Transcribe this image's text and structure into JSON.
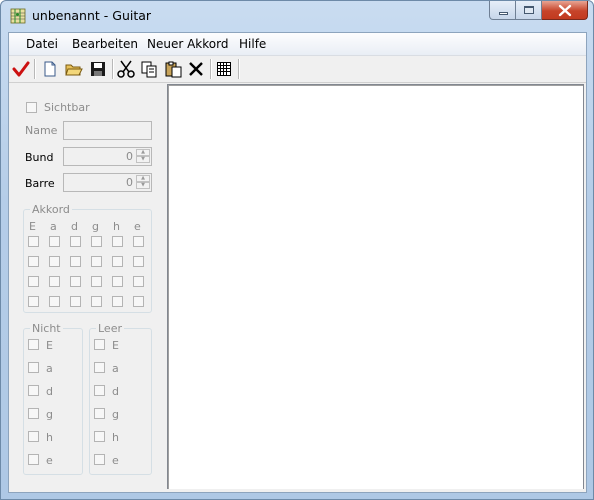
{
  "window": {
    "title": "unbenannt - Guitar"
  },
  "menubar": {
    "items": [
      "Datei",
      "Bearbeiten",
      "Neuer Akkord",
      "Hilfe"
    ]
  },
  "toolbar": {
    "icons": [
      "checkmark-icon",
      "new-file-icon",
      "open-folder-icon",
      "save-icon",
      "cut-icon",
      "copy-icon",
      "paste-icon",
      "delete-icon",
      "grid-icon"
    ]
  },
  "panel": {
    "visible_label": "Sichtbar",
    "name_label": "Name",
    "name_value": "",
    "fret_label": "Bund",
    "fret_value": "0",
    "barre_label": "Barre",
    "barre_value": "0",
    "chord_group": {
      "title": "Akkord",
      "strings": [
        "E",
        "a",
        "d",
        "g",
        "h",
        "e"
      ],
      "rows": 4
    },
    "not_group": {
      "title": "Nicht",
      "strings": [
        "E",
        "a",
        "d",
        "g",
        "h",
        "e"
      ]
    },
    "empty_group": {
      "title": "Leer",
      "strings": [
        "E",
        "a",
        "d",
        "g",
        "h",
        "e"
      ]
    }
  }
}
